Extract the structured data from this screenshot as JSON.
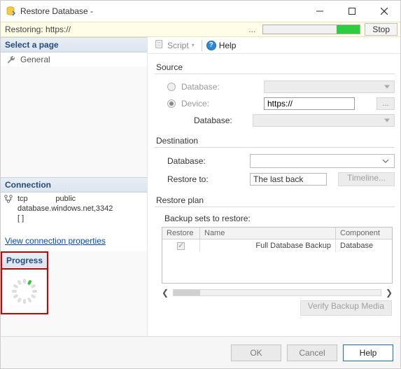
{
  "window": {
    "title": "Restore Database -",
    "min_tip": "Minimize",
    "max_tip": "Maximize",
    "close_tip": "Close"
  },
  "banner": {
    "text": "Restoring: https://",
    "stop": "Stop"
  },
  "leftPane": {
    "selectPage": "Select a page",
    "pages": [
      {
        "label": "General"
      }
    ],
    "connection": {
      "title": "Connection",
      "line1": "tcp",
      "line1b": "public",
      "line2": "database.windows.net,3342",
      "line3": "[            ]"
    },
    "viewProps": "View connection properties",
    "progress": "Progress"
  },
  "toolbar": {
    "script": "Script",
    "help": "Help"
  },
  "source": {
    "title": "Source",
    "database_label": "Database:",
    "device_label": "Device:",
    "device_value": "https://",
    "browse": "...",
    "db2_label": "Database:"
  },
  "destination": {
    "title": "Destination",
    "database_label": "Database:",
    "database_value": "",
    "restoreto_label": "Restore to:",
    "restoreto_value": "The last back",
    "timeline": "Timeline..."
  },
  "plan": {
    "title": "Restore plan",
    "subtitle": "Backup sets to restore:",
    "columns": {
      "restore": "Restore",
      "name": "Name",
      "component": "Component"
    },
    "rows": [
      {
        "checked": true,
        "name": "Full Database Backup",
        "component": "Database"
      }
    ],
    "verify": "Verify Backup Media"
  },
  "footer": {
    "ok": "OK",
    "cancel": "Cancel",
    "help": "Help"
  }
}
